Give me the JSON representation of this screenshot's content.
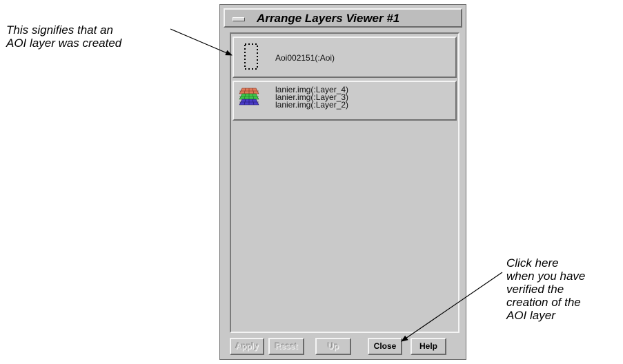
{
  "annotations": {
    "left_callout": [
      "This signifies that an",
      "AOI layer was created"
    ],
    "right_callout": [
      "Click here",
      "when you have",
      "verified the",
      "creation of the",
      "AOI layer"
    ]
  },
  "window": {
    "title": "Arrange Layers Viewer #1",
    "menu_icon": "window-menu-icon"
  },
  "layers": [
    {
      "icon": "aoi-layer-icon",
      "lines": [
        "Aoi002151(:Aoi)"
      ]
    },
    {
      "icon": "raster-layers-icon",
      "lines": [
        "lanier.img(:Layer_4)",
        "lanier.img(:Layer_3)",
        "lanier.img(:Layer_2)"
      ]
    }
  ],
  "buttons": {
    "apply": "Apply",
    "reset": "Reset",
    "up": "Up",
    "close": "Close",
    "help": "Help"
  },
  "colors": {
    "raster_top": "#e07a5a",
    "raster_middle": "#3fc44a",
    "raster_bottom": "#4a3cc8"
  }
}
